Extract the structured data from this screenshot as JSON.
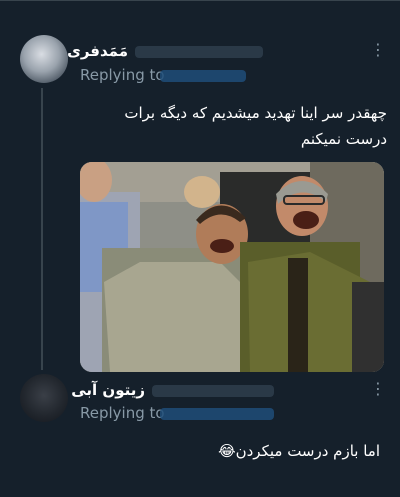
{
  "tweets": [
    {
      "display_name": "مَمَدفری",
      "replying_prefix": "Replying to",
      "text": "چهقدر سر اینا تهدید میشدیم که دیگه برات درست نمیکنم",
      "more_label": "⋮"
    },
    {
      "display_name": "زیتون آبی",
      "replying_prefix": "Replying to",
      "text": "اما بازم درست میکردن😂",
      "more_label": "⋮"
    }
  ],
  "media": {
    "description_icon": "laughing-men-photo"
  }
}
